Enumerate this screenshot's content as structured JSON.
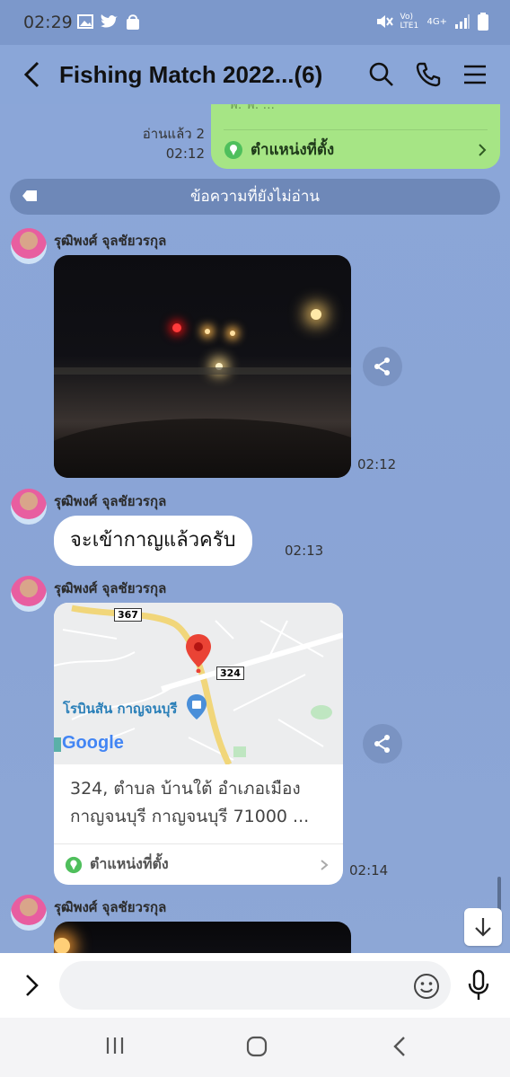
{
  "status_bar": {
    "time": "02:29",
    "network": "4G+",
    "volte": "Vo) LTE1"
  },
  "header": {
    "title": "Fishing Match 2022...(6)"
  },
  "top_location": {
    "cut_text": "ฟ. ฟ. ...",
    "label": "ตำแหน่งที่ตั้ง",
    "read_label": "อ่านแล้ว 2",
    "time": "02:12"
  },
  "unread_divider": {
    "label": "ข้อความที่ยังไม่อ่าน"
  },
  "messages": [
    {
      "sender": "รุฒิพงศ์ จุลชัยวรกุล",
      "type": "photo",
      "time": "02:12"
    },
    {
      "sender": "รุฒิพงศ์ จุลชัยวรกุล",
      "type": "text",
      "text": "จะเข้ากาญแล้วครับ",
      "time": "02:13"
    },
    {
      "sender": "รุฒิพงศ์ จุลชัยวรกุล",
      "type": "location",
      "map": {
        "road1": "367",
        "road2": "324",
        "place": "โรบินสัน กาญจนบุรี",
        "logo": "Google"
      },
      "address": "324, ตำบล บ้านใต้ อำเภอเมือง กาญจนบุรี กาญจนบุรี 71000 ...",
      "label": "ตำแหน่งที่ตั้ง",
      "time": "02:14"
    },
    {
      "sender": "รุฒิพงศ์ จุลชัยวรกุล",
      "type": "photo"
    }
  ],
  "input": {
    "placeholder": ""
  },
  "colors": {
    "chat_bg": "#8aa5d6",
    "bubble_sent": "#a6e585",
    "unread_bar": "#6e88b8"
  }
}
